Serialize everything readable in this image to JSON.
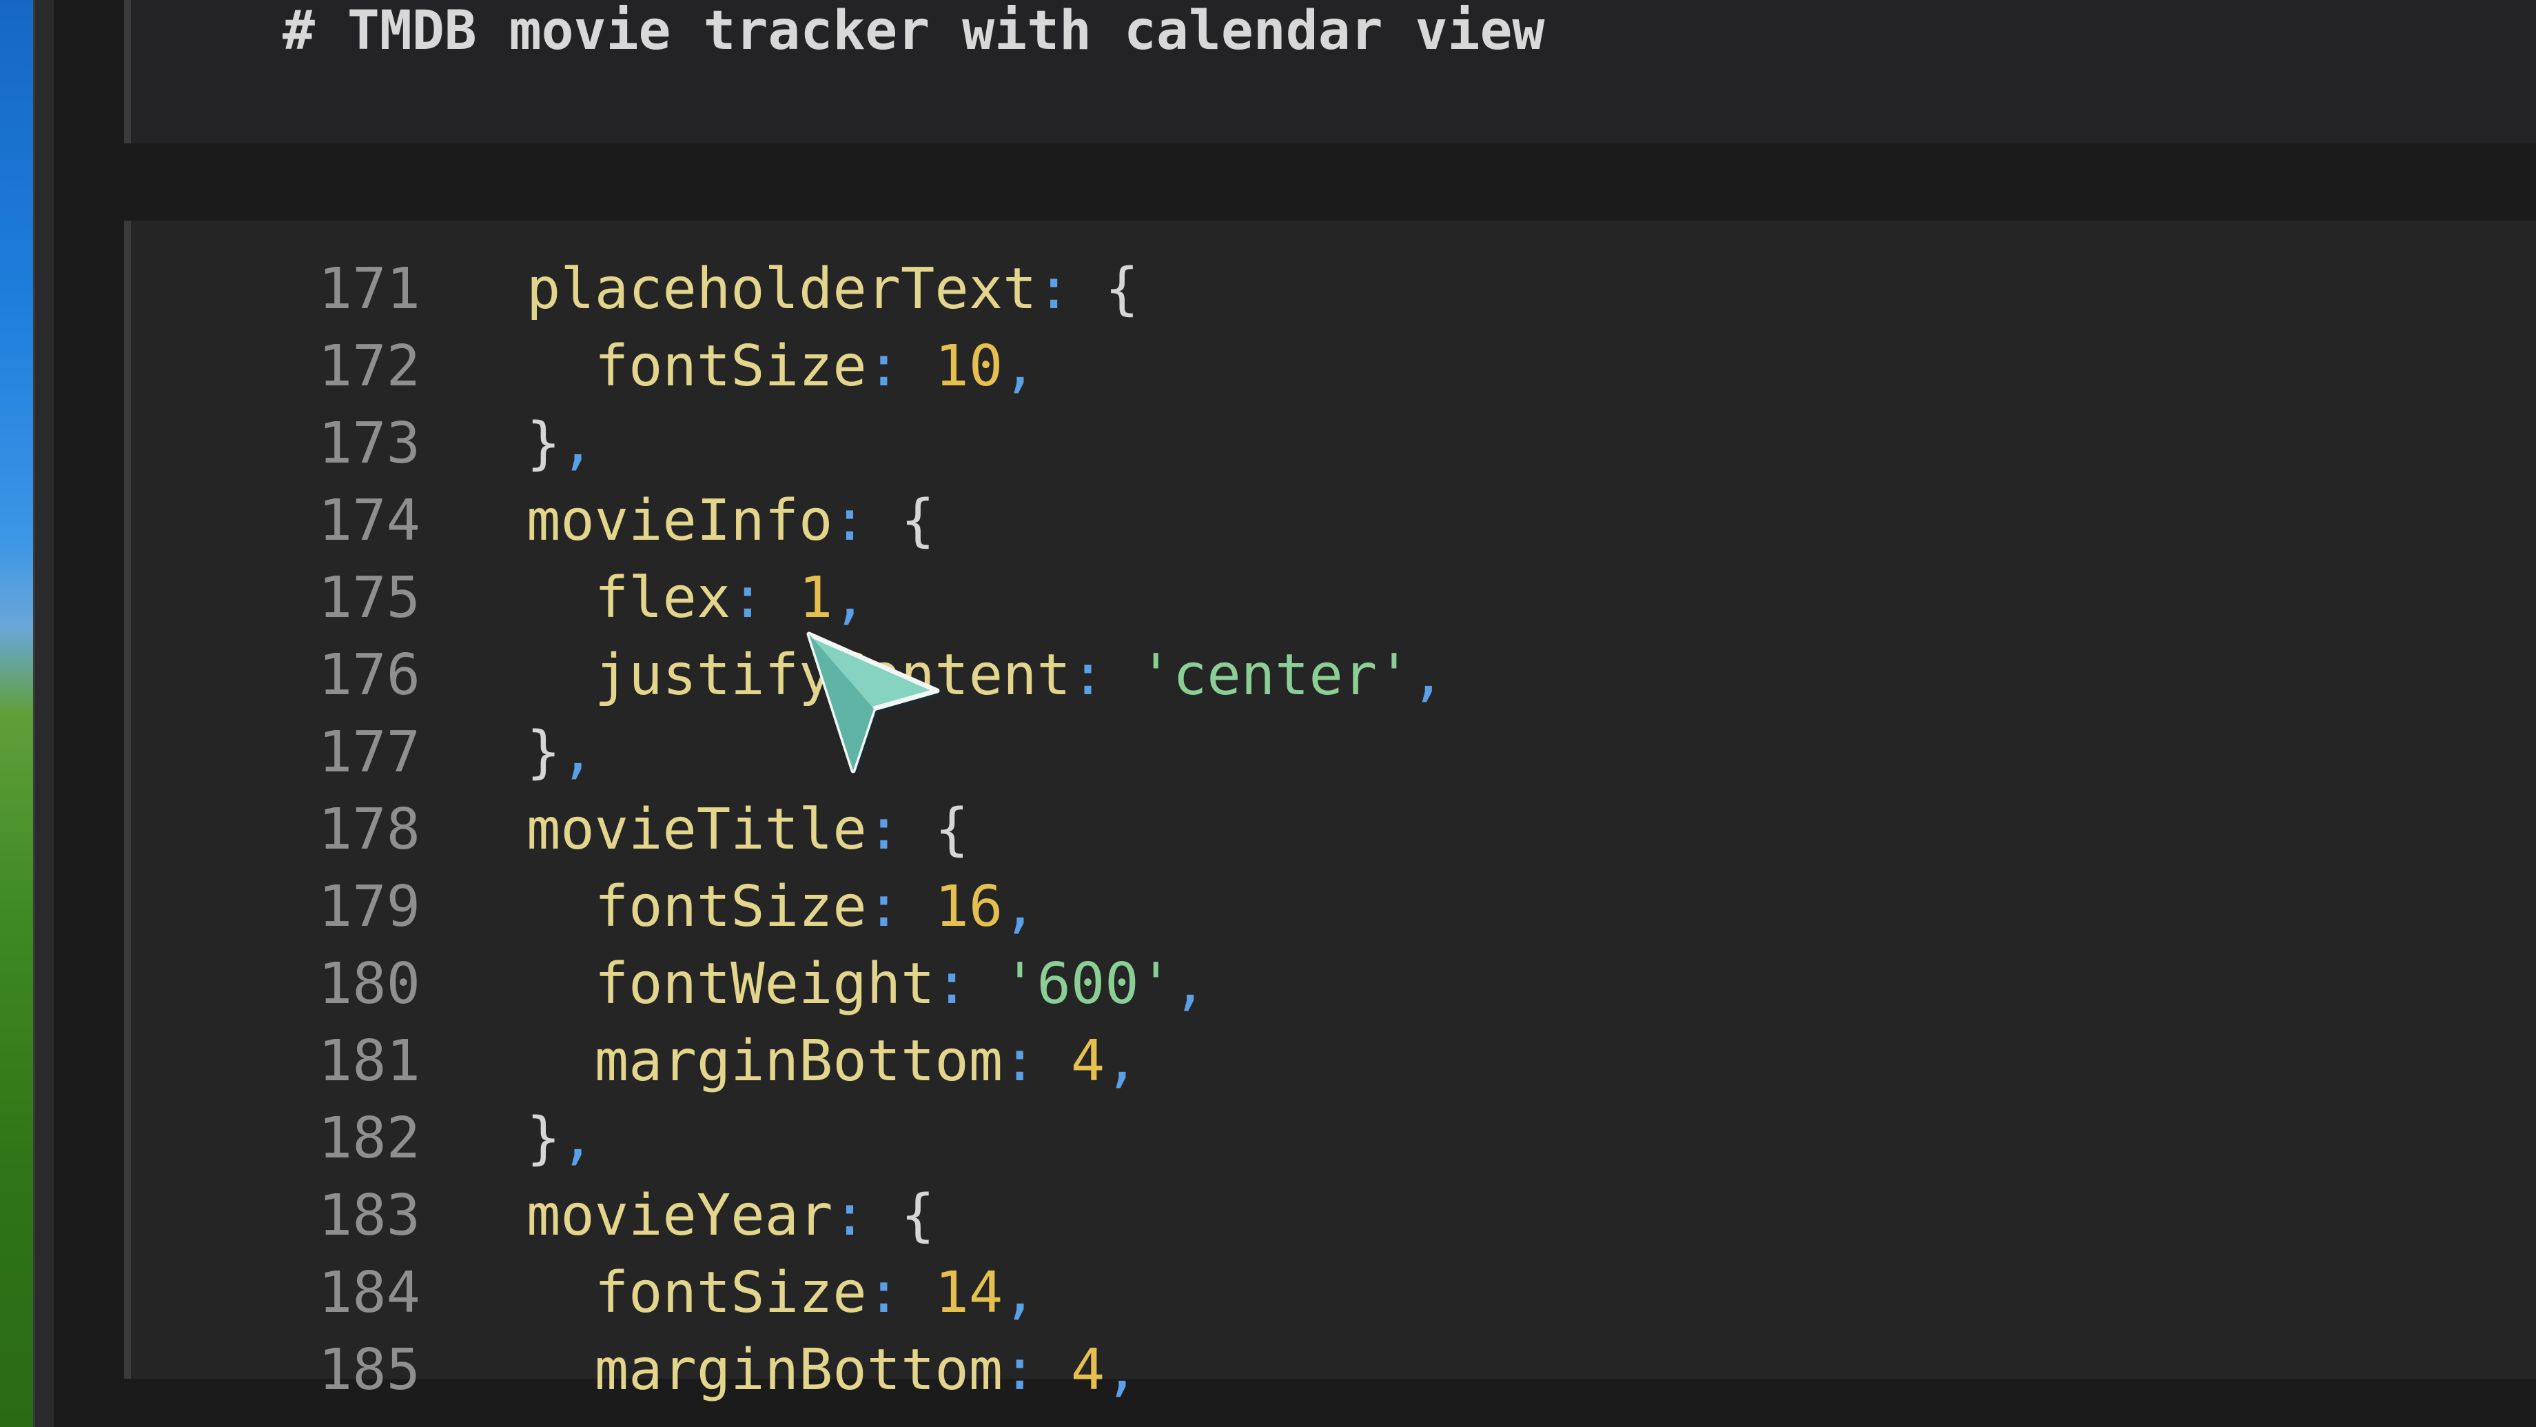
{
  "prompt": {
    "text": "# TMDB movie tracker with calendar view"
  },
  "colors": {
    "background": "#1b1b1c",
    "panel": "#252526",
    "property": "#e3d58c",
    "punctuation": "#5aa0e6",
    "number": "#e6c04e",
    "string": "#8ccf96",
    "line_number": "#8f8f8f",
    "cursor": "#7fd1b9"
  },
  "editor": {
    "lines": [
      {
        "num": "171",
        "indent": "",
        "key": "placeholderText",
        "colon": ": ",
        "value": "",
        "vtype": "brace",
        "open": "{",
        "comma": ""
      },
      {
        "num": "172",
        "indent": "  ",
        "key": "fontSize",
        "colon": ": ",
        "value": "10",
        "vtype": "num",
        "open": "",
        "comma": ","
      },
      {
        "num": "173",
        "indent": "",
        "key": "",
        "colon": "",
        "value": "",
        "vtype": "",
        "close": "}",
        "comma": ","
      },
      {
        "num": "174",
        "indent": "",
        "key": "movieInfo",
        "colon": ": ",
        "value": "",
        "vtype": "brace",
        "open": "{",
        "comma": ""
      },
      {
        "num": "175",
        "indent": "  ",
        "key": "flex",
        "colon": ": ",
        "value": "1",
        "vtype": "num",
        "open": "",
        "comma": ","
      },
      {
        "num": "176",
        "indent": "  ",
        "key": "justifyContent",
        "colon": ": ",
        "value": "'center'",
        "vtype": "str",
        "open": "",
        "comma": ","
      },
      {
        "num": "177",
        "indent": "",
        "key": "",
        "colon": "",
        "value": "",
        "vtype": "",
        "close": "}",
        "comma": ","
      },
      {
        "num": "178",
        "indent": "",
        "key": "movieTitle",
        "colon": ": ",
        "value": "",
        "vtype": "brace",
        "open": "{",
        "comma": ""
      },
      {
        "num": "179",
        "indent": "  ",
        "key": "fontSize",
        "colon": ": ",
        "value": "16",
        "vtype": "num",
        "open": "",
        "comma": ","
      },
      {
        "num": "180",
        "indent": "  ",
        "key": "fontWeight",
        "colon": ": ",
        "value": "'600'",
        "vtype": "str",
        "open": "",
        "comma": ","
      },
      {
        "num": "181",
        "indent": "  ",
        "key": "marginBottom",
        "colon": ": ",
        "value": "4",
        "vtype": "num",
        "open": "",
        "comma": ","
      },
      {
        "num": "182",
        "indent": "",
        "key": "",
        "colon": "",
        "value": "",
        "vtype": "",
        "close": "}",
        "comma": ","
      },
      {
        "num": "183",
        "indent": "",
        "key": "movieYear",
        "colon": ": ",
        "value": "",
        "vtype": "brace",
        "open": "{",
        "comma": ""
      },
      {
        "num": "184",
        "indent": "  ",
        "key": "fontSize",
        "colon": ": ",
        "value": "14",
        "vtype": "num",
        "open": "",
        "comma": ","
      },
      {
        "num": "185",
        "indent": "  ",
        "key": "marginBottom",
        "colon": ": ",
        "value": "4",
        "vtype": "num",
        "open": "",
        "comma": ","
      }
    ]
  }
}
